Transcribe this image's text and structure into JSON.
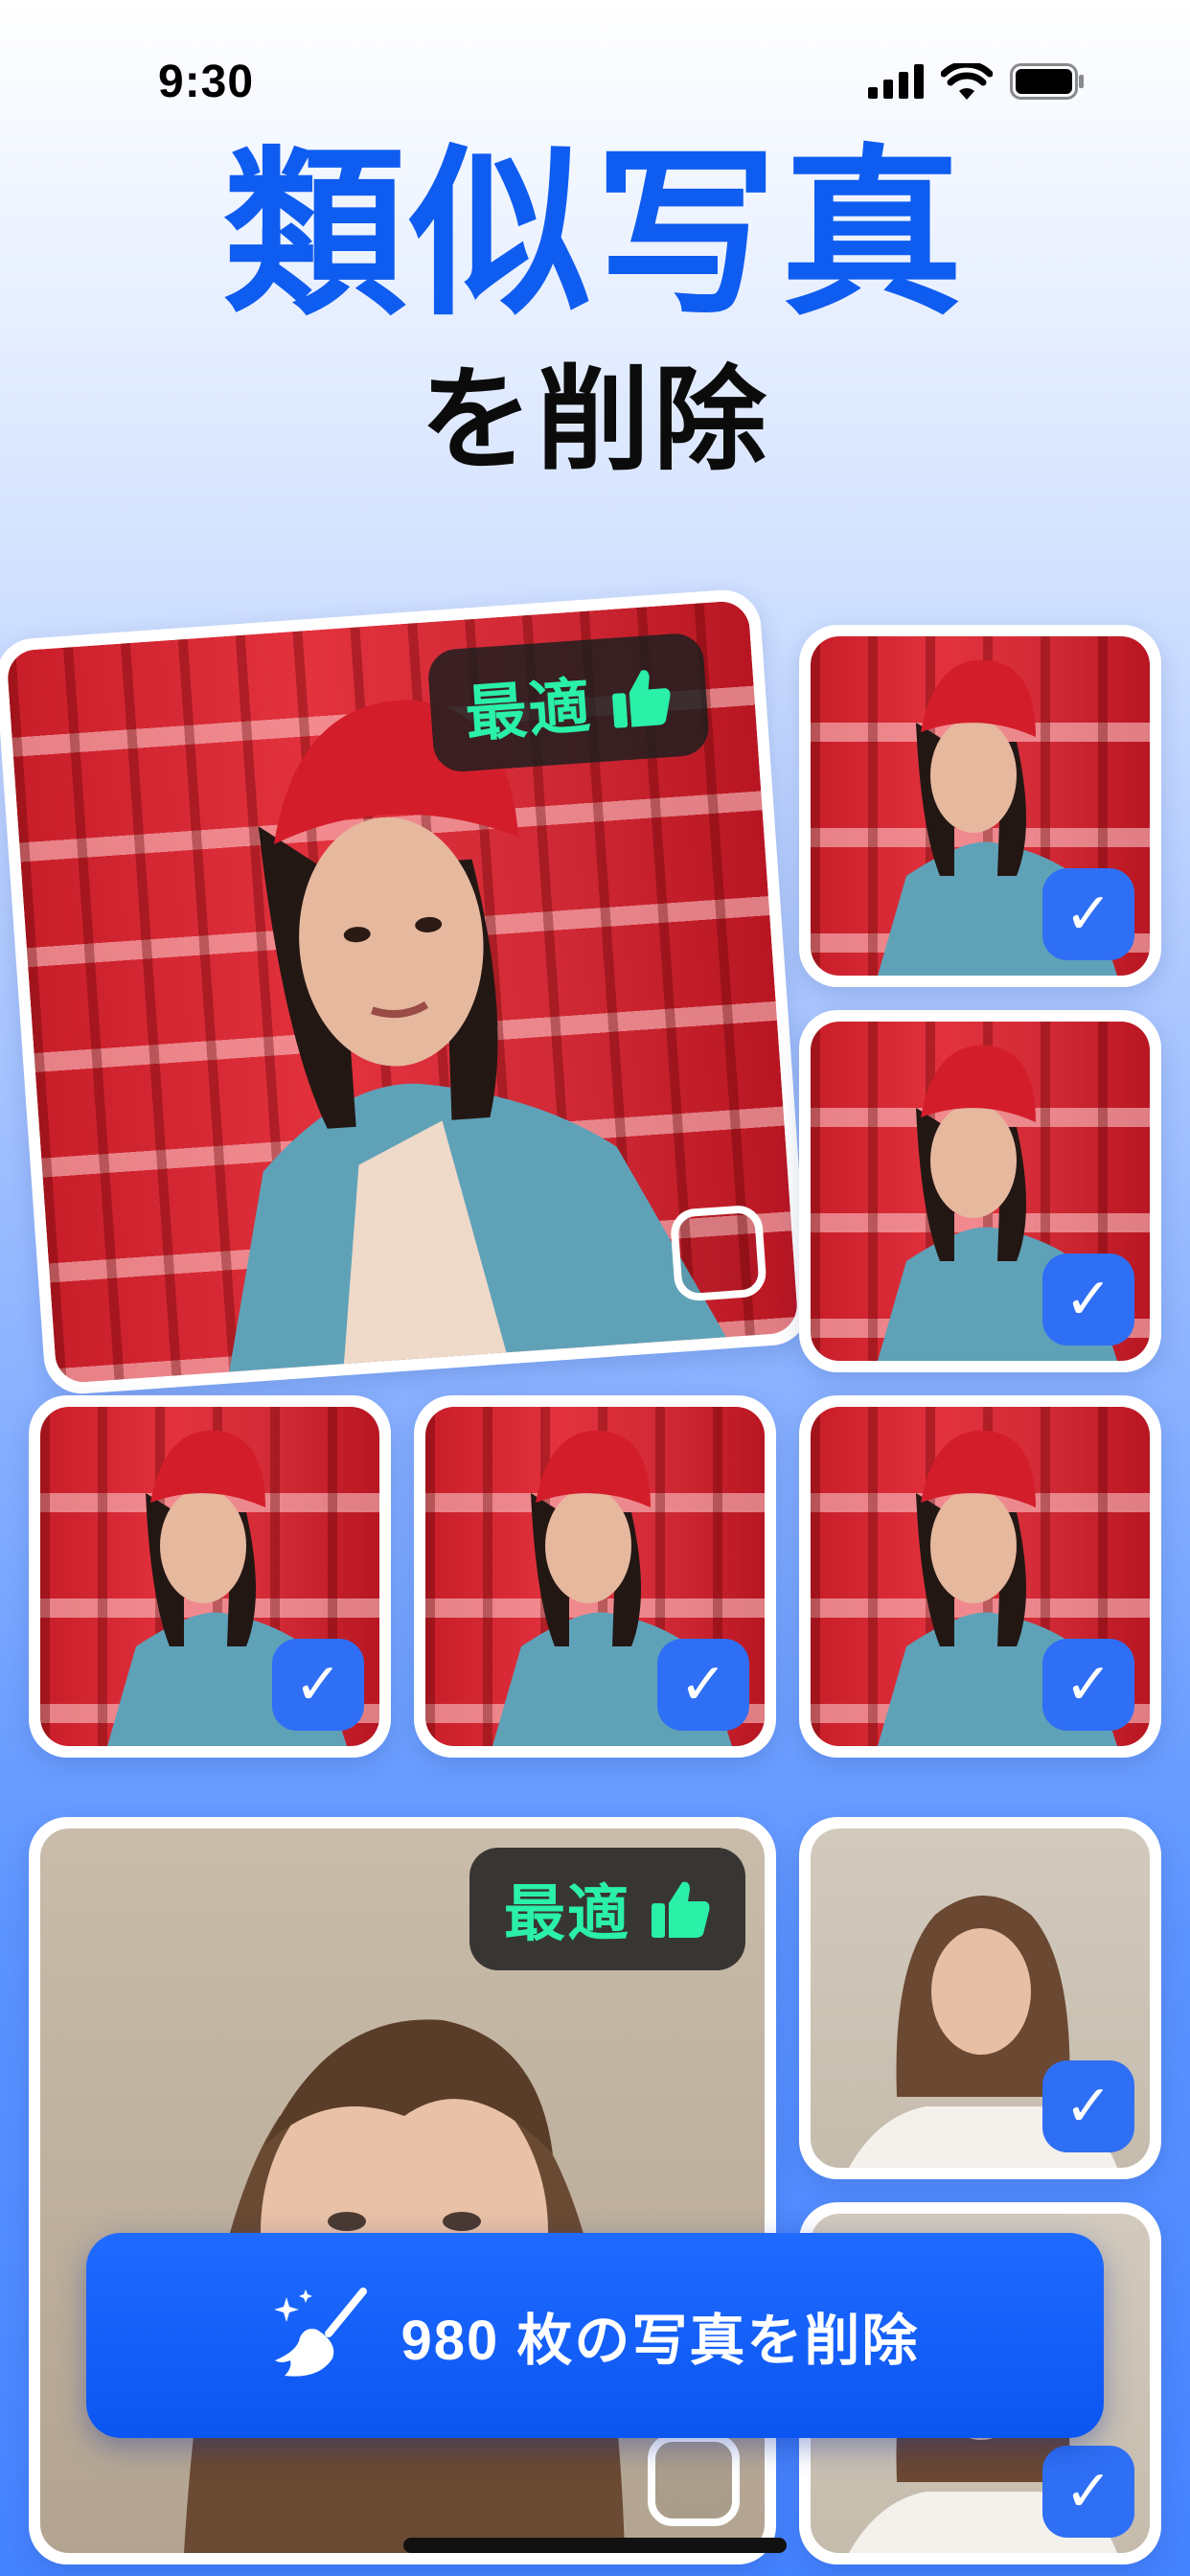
{
  "status_bar": {
    "time": "9:30",
    "icons": [
      "signal-icon",
      "wifi-icon",
      "battery-icon"
    ]
  },
  "header": {
    "title": "類似写真",
    "subtitle": "を削除"
  },
  "badges": {
    "best_label": "最適"
  },
  "groups": [
    {
      "best_photo": {
        "selected": false
      },
      "duplicates": [
        {
          "selected": true
        },
        {
          "selected": true
        },
        {
          "selected": true
        },
        {
          "selected": true
        },
        {
          "selected": true
        }
      ]
    },
    {
      "best_photo": {
        "selected": false
      },
      "duplicates": [
        {
          "selected": true
        },
        {
          "selected": true
        }
      ]
    }
  ],
  "cta": {
    "label": "980 枚の写真を削除",
    "icon": "broom-sparkle-icon"
  },
  "colors": {
    "accent": "#0f5cf0",
    "checkbox": "#2f6ff5",
    "badge_text": "#2af0a8"
  }
}
